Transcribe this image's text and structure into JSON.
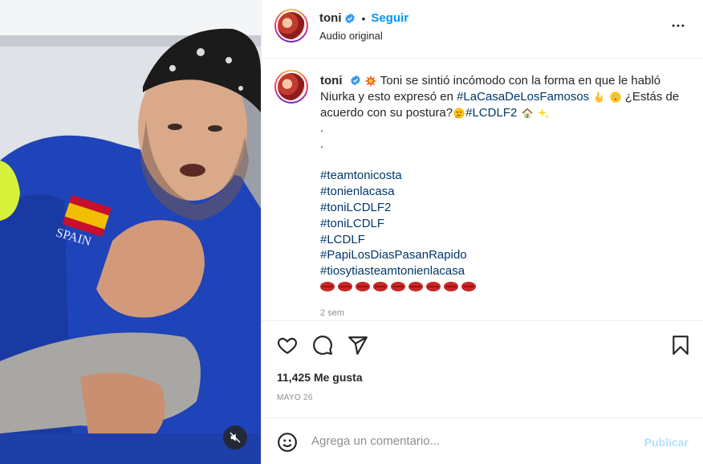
{
  "header": {
    "username": "toni",
    "separator": "•",
    "follow_label": "Seguir",
    "audio_label": "Audio original",
    "more_icon": "more-horizontal-icon"
  },
  "caption": {
    "username": "toni",
    "text_before": "Toni se sintió incómodo con la forma en que le habló Niurka y esto expresó en ",
    "hashtag1": "#LaCasaDeLosFamosos",
    "text_middle": " ¿Estás de acuerdo con su postura?",
    "hashtag2": "#LCDLF2",
    "dots": [
      ".",
      "."
    ],
    "hashtags": [
      "#teamtonicosta",
      "#tonienlacasa",
      "#toniLCDLF2",
      "#toniLCDLF",
      "#LCDLF",
      "#PapiLosDiasPasanRapido",
      "#tiosytiasteamtonienlacasa"
    ],
    "time": "2 sem"
  },
  "actions": {
    "likes": "11,425 Me gusta",
    "date": "MAYO 26"
  },
  "comment": {
    "placeholder": "Agrega un comentario...",
    "publish_label": "Publicar"
  },
  "colors": {
    "accent": "#0095f6",
    "hashtag": "#00376b",
    "muted": "#8e8e8e",
    "publish_disabled": "#b2dffc",
    "verified": "#3897f0"
  }
}
